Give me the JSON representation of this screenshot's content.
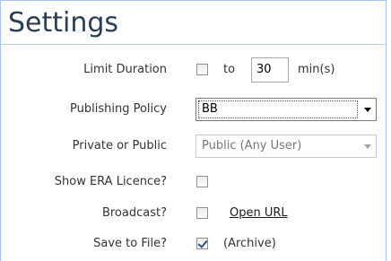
{
  "title": "Settings",
  "rows": {
    "limit_duration": {
      "label": "Limit Duration",
      "checked": false,
      "to_text": "to",
      "value": "30",
      "unit": "min(s)"
    },
    "publishing_policy": {
      "label": "Publishing Policy",
      "selected": "BB"
    },
    "private_or_public": {
      "label": "Private or Public",
      "selected": "Public (Any User)",
      "disabled": true
    },
    "show_era_licence": {
      "label": "Show ERA Licence?",
      "checked": false
    },
    "broadcast": {
      "label": "Broadcast?",
      "checked": false,
      "link_text": "Open URL"
    },
    "save_to_file": {
      "label": "Save to File?",
      "checked": true,
      "note": "(Archive)"
    }
  },
  "colors": {
    "title": "#2b3e55",
    "border": "#a9c4e6",
    "text": "#333333"
  }
}
